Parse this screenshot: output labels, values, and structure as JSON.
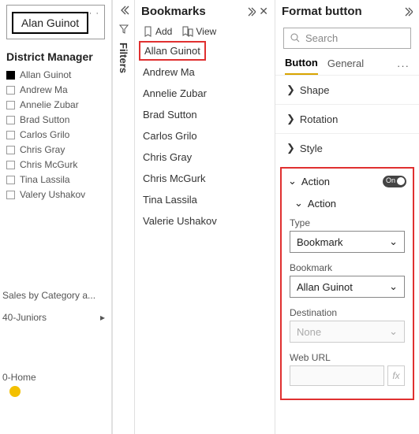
{
  "left": {
    "button_label": "Alan Guinot",
    "dm_title": "District Manager",
    "managers": [
      {
        "label": "Allan Guinot",
        "checked": true
      },
      {
        "label": "Andrew Ma",
        "checked": false
      },
      {
        "label": "Annelie Zubar",
        "checked": false
      },
      {
        "label": "Brad Sutton",
        "checked": false
      },
      {
        "label": "Carlos Grilo",
        "checked": false
      },
      {
        "label": "Chris Gray",
        "checked": false
      },
      {
        "label": "Chris McGurk",
        "checked": false
      },
      {
        "label": "Tina Lassila",
        "checked": false
      },
      {
        "label": "Valery Ushakov",
        "checked": false
      }
    ],
    "sales_label": "Sales by Category a...",
    "juniors_label": "40-Juniors",
    "home_label": "0-Home"
  },
  "filters": {
    "label": "Filters"
  },
  "bookmarks": {
    "title": "Bookmarks",
    "add": "Add",
    "view": "View",
    "items": [
      "Allan Guinot",
      "Andrew Ma",
      "Annelie Zubar",
      "Brad Sutton",
      "Carlos Grilo",
      "Chris Gray",
      "Chris McGurk",
      "Tina Lassila",
      "Valerie Ushakov"
    ]
  },
  "format": {
    "title": "Format button",
    "search_ph": "Search",
    "tab_button": "Button",
    "tab_general": "General",
    "sections": {
      "shape": "Shape",
      "rotation": "Rotation",
      "style": "Style"
    },
    "action": {
      "header": "Action",
      "sub": "Action",
      "type_label": "Type",
      "type_val": "Bookmark",
      "bookmark_label": "Bookmark",
      "bookmark_val": "Allan Guinot",
      "dest_label": "Destination",
      "dest_val": "None",
      "url_label": "Web URL"
    }
  }
}
